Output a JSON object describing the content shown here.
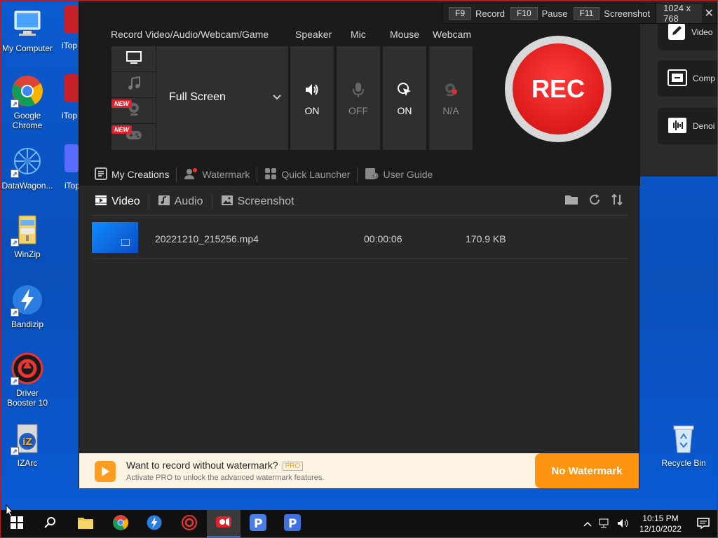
{
  "desktop": {
    "icons": [
      {
        "label": "My Computer"
      },
      {
        "label": "Google Chrome"
      },
      {
        "label": "DataWagon..."
      },
      {
        "label": "WinZip"
      },
      {
        "label": "Bandizip"
      },
      {
        "label": "Driver Booster 10"
      },
      {
        "label": "IZArc"
      },
      {
        "label": "Recycle Bin"
      }
    ],
    "partial_labels": [
      "iTop Rec",
      "iTop Ed",
      "iTop"
    ]
  },
  "hotkeys": {
    "record_key": "F9",
    "record_label": "Record",
    "pause_key": "F10",
    "pause_label": "Pause",
    "screenshot_key": "F11",
    "screenshot_label": "Screenshot",
    "resolution": "1024 x 768",
    "close": "✕"
  },
  "recorder": {
    "source_header": "Record Video/Audio/Webcam/Game",
    "speaker_header": "Speaker",
    "mic_header": "Mic",
    "mouse_header": "Mouse",
    "webcam_header": "Webcam",
    "mode_value": "Full Screen",
    "new_badge": "NEW",
    "speaker_value": "ON",
    "mic_value": "OFF",
    "mouse_value": "ON",
    "webcam_value": "N/A",
    "rec_label": "REC"
  },
  "nav": {
    "my_creations": "My Creations",
    "watermark": "Watermark",
    "quick_launcher": "Quick Launcher",
    "user_guide": "User Guide"
  },
  "tabs": {
    "video": "Video",
    "audio": "Audio",
    "screenshot": "Screenshot"
  },
  "files": [
    {
      "name": "20221210_215256.mp4",
      "duration": "00:00:06",
      "size": "170.9 KB"
    }
  ],
  "promo": {
    "title": "Want to record without watermark?",
    "badge": "PRO",
    "subtitle": "Activate PRO to unlock the advanced watermark features.",
    "button": "No Watermark"
  },
  "side_panel": {
    "items": [
      {
        "label": "Video"
      },
      {
        "label": "Comp"
      },
      {
        "label": "Denoi"
      }
    ]
  },
  "taskbar": {
    "time": "10:15 PM",
    "date": "12/10/2022"
  }
}
